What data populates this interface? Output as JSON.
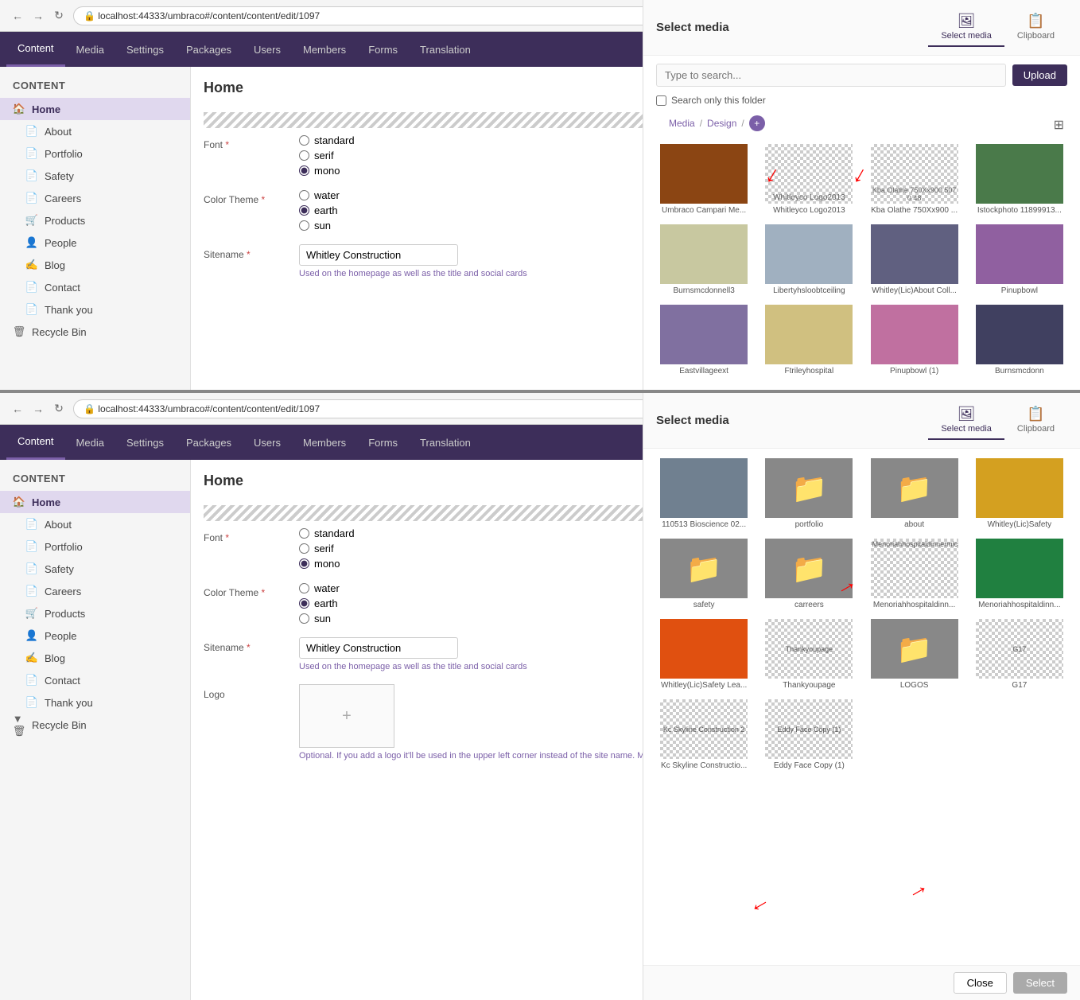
{
  "browser": {
    "url": "localhost:44333/umbraco#/content/content/edit/1097",
    "back_label": "←",
    "forward_label": "→",
    "refresh_label": "↻"
  },
  "nav": {
    "items": [
      {
        "label": "Content",
        "active": true
      },
      {
        "label": "Media",
        "active": false
      },
      {
        "label": "Settings",
        "active": false
      },
      {
        "label": "Packages",
        "active": false
      },
      {
        "label": "Users",
        "active": false
      },
      {
        "label": "Members",
        "active": false
      },
      {
        "label": "Forms",
        "active": false
      },
      {
        "label": "Translation",
        "active": false
      }
    ]
  },
  "sidebar": {
    "title": "Content",
    "items": [
      {
        "label": "Home",
        "icon": "🏠",
        "level": 0,
        "active": true
      },
      {
        "label": "About",
        "icon": "📄",
        "level": 1
      },
      {
        "label": "Portfolio",
        "icon": "📄",
        "level": 1
      },
      {
        "label": "Safety",
        "icon": "📄",
        "level": 1
      },
      {
        "label": "Careers",
        "icon": "📄",
        "level": 1
      },
      {
        "label": "Products",
        "icon": "🛒",
        "level": 1
      },
      {
        "label": "People",
        "icon": "👤",
        "level": 1
      },
      {
        "label": "Blog",
        "icon": "✍",
        "level": 1
      },
      {
        "label": "Contact",
        "icon": "📄",
        "level": 1
      },
      {
        "label": "Thank you",
        "icon": "📄",
        "level": 1
      },
      {
        "label": "Recycle Bin",
        "icon": "🗑",
        "level": 0
      }
    ]
  },
  "content": {
    "header": "Home",
    "form": {
      "font_label": "Font",
      "font_required": true,
      "font_options": [
        "standard",
        "serif",
        "mono"
      ],
      "font_selected": "mono",
      "color_theme_label": "Color Theme",
      "color_theme_required": true,
      "color_options": [
        "water",
        "earth",
        "sun"
      ],
      "color_selected": "earth",
      "sitename_label": "Sitename",
      "sitename_required": true,
      "sitename_value": "Whitley Construction",
      "sitename_note": "Used on the homepage as well as the title and social cards",
      "logo_label": "Logo",
      "logo_note": "Optional. If you add a logo it'll be used in the upper left corner instead of the site name. Make sure to use a transparent logo for best results"
    }
  },
  "select_media_top": {
    "title": "Select media",
    "tab_select": "Select media",
    "tab_clipboard": "Clipboard",
    "search_placeholder": "Type to search...",
    "search_folder_label": "Search only this folder",
    "upload_btn": "Upload",
    "breadcrumb": [
      "Media",
      "Design"
    ],
    "add_folder": "+",
    "media_items": [
      {
        "label": "Umbraco Campari Me...",
        "type": "image",
        "color": "#8B4513"
      },
      {
        "label": "Whitleyco Logo2013",
        "type": "checkerboard"
      },
      {
        "label": "Kba Olathe 750Xx900 ...",
        "type": "checkerboard"
      },
      {
        "label": "Istockphoto 11899913...",
        "type": "image",
        "color": "#4a7a4a"
      },
      {
        "label": "Burnsmcdonnell3",
        "type": "image",
        "color": "#c8c8a0"
      },
      {
        "label": "Libertyhsloobtceiling",
        "type": "image",
        "color": "#a0b0c0"
      },
      {
        "label": "Whitley(Lic)About Coll...",
        "type": "image",
        "color": "#606080"
      },
      {
        "label": "Pinupbowl",
        "type": "image",
        "color": "#9060a0"
      },
      {
        "label": "Eastvillageext",
        "type": "image",
        "color": "#8070a0"
      },
      {
        "label": "Ftrileyhospital",
        "type": "image",
        "color": "#d0c080"
      },
      {
        "label": "Pinupbowl (1)",
        "type": "image",
        "color": "#c070a0"
      },
      {
        "label": "Burnsmcdonn",
        "type": "image",
        "color": "#404060"
      }
    ]
  },
  "select_media_bottom": {
    "title": "Select media",
    "tab_select": "Select media",
    "tab_clipboard": "Clipboard",
    "media_items": [
      {
        "label": "110513 Bioscience 02...",
        "type": "image",
        "color": "#708090"
      },
      {
        "label": "portfolio",
        "type": "folder"
      },
      {
        "label": "about",
        "type": "folder"
      },
      {
        "label": "Whitley(Lic)Safety",
        "type": "image",
        "color": "#d4a020"
      },
      {
        "label": "safety",
        "type": "folder"
      },
      {
        "label": "carreers",
        "type": "folder"
      },
      {
        "label": "Menoriahhospitaldinn...",
        "type": "checkerboard_small"
      },
      {
        "label": "Menoriahhospitaldinn...",
        "type": "image",
        "color": "#208040"
      },
      {
        "label": "Whitley(Lic)Safety Lea...",
        "type": "image",
        "color": "#e05010"
      },
      {
        "label": "Thankyoupage",
        "type": "checkerboard_small"
      },
      {
        "label": "LOGOS",
        "type": "folder"
      },
      {
        "label": "G17",
        "type": "checkerboard_small"
      },
      {
        "label": "Kc Skyline Constructio...",
        "type": "checkerboard_small"
      },
      {
        "label": "Eddy Face Copy (1)",
        "type": "checkerboard_small"
      }
    ],
    "close_btn": "Close",
    "select_btn": "Select"
  }
}
